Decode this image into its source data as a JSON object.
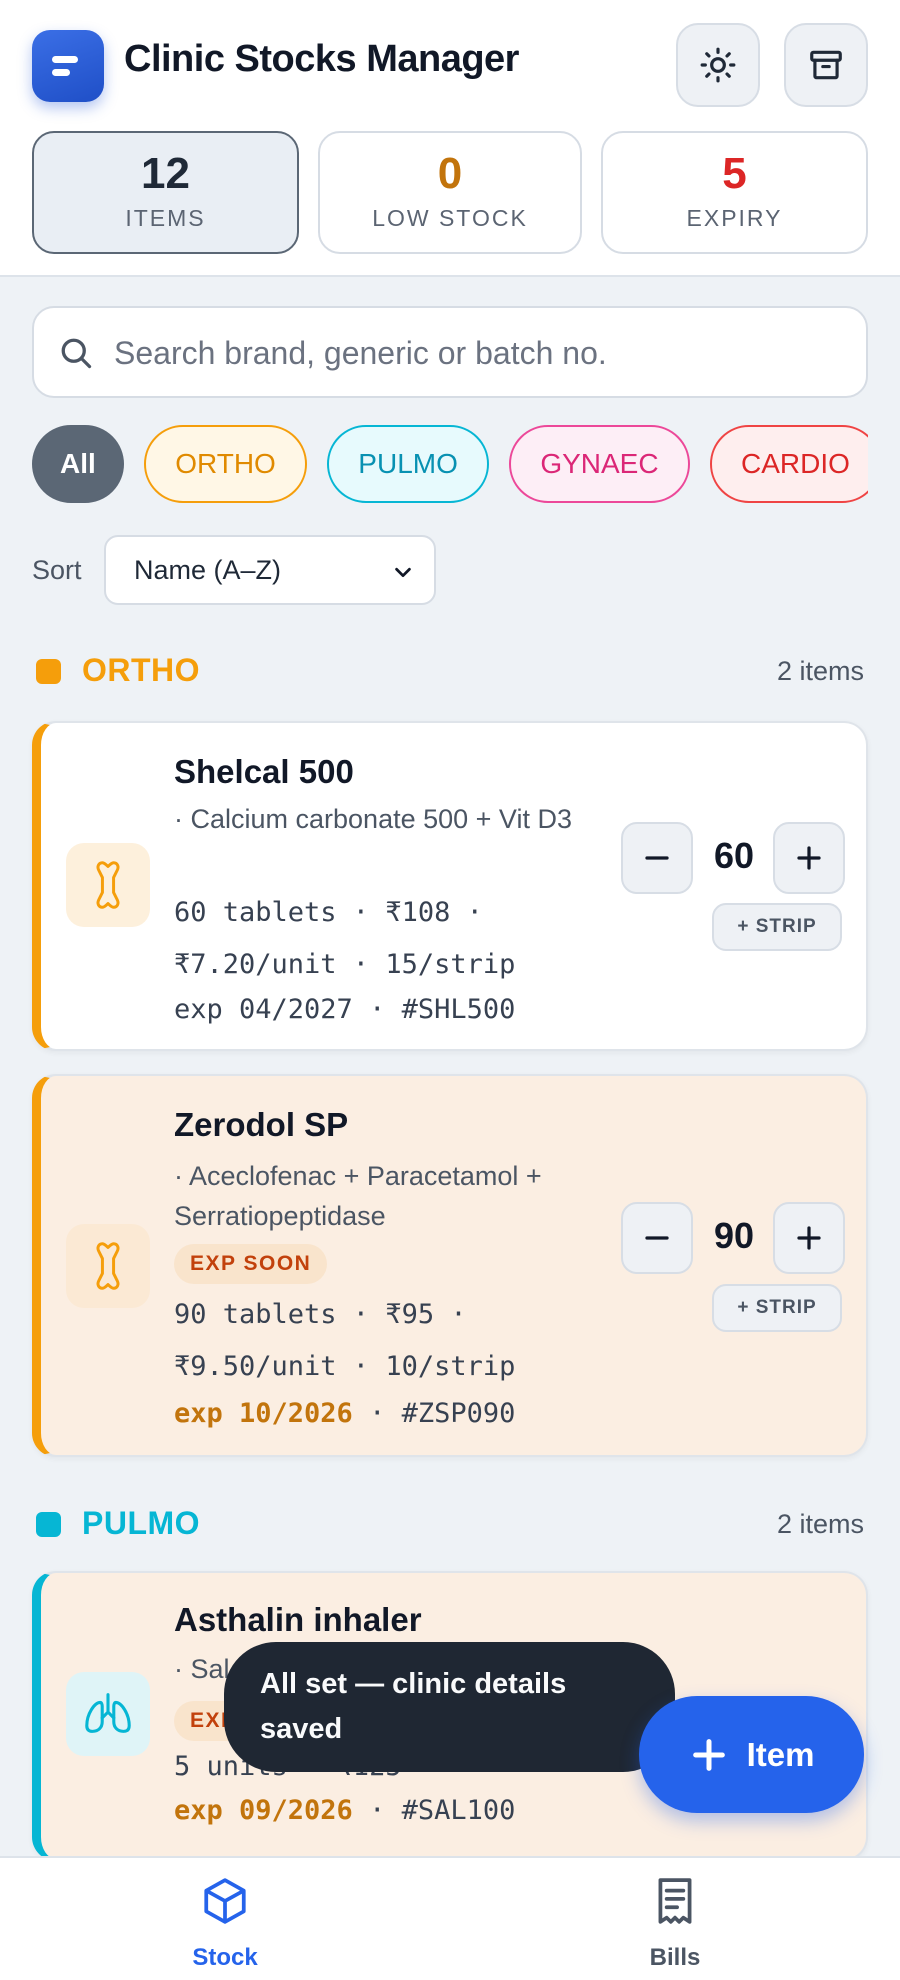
{
  "app": {
    "title": "Clinic Stocks Manager"
  },
  "header": {
    "theme_icon": "sun-icon",
    "archive_icon": "archive-icon"
  },
  "stats": [
    {
      "value": "12",
      "label": "ITEMS",
      "color": "#1f2937"
    },
    {
      "value": "0",
      "label": "LOW STOCK",
      "color": "#c2740c"
    },
    {
      "value": "5",
      "label": "EXPIRY",
      "color": "#dc2626"
    }
  ],
  "search": {
    "placeholder": "Search brand, generic or batch no.",
    "value": ""
  },
  "filters": [
    {
      "label": "All",
      "selected": true
    },
    {
      "label": "ORTHO",
      "color": "#f59e0b"
    },
    {
      "label": "PULMO",
      "color": "#06b6d4"
    },
    {
      "label": "GYNAEC",
      "color": "#ec4899"
    },
    {
      "label": "CARDIO",
      "color": "#ef4444"
    }
  ],
  "sort": {
    "label": "Sort",
    "selected": "Name (A–Z)"
  },
  "sections": [
    {
      "name": "ORTHO",
      "count": "2 items",
      "color": "#f59e0b",
      "items": [
        {
          "brand": "Shelcal 500",
          "generic": "· Calcium carbonate 500 + Vit D3",
          "meta1": "60 tablets · ₹108 ·",
          "meta2": "₹7.20/unit · 15/strip",
          "exp": "exp 04/2027",
          "batch": " · #SHL500",
          "qty": "60",
          "strip_label": "+ STRIP",
          "icon": "bone-icon"
        },
        {
          "brand": "Zerodol SP",
          "generic": "· Aceclofenac + Paracetamol + Serratiopeptidase",
          "badge": "EXP SOON",
          "meta1": "90 tablets · ₹95 ·",
          "meta2": "₹9.50/unit · 10/strip",
          "exp": "exp 10/2026",
          "batch": " · #ZSP090",
          "qty": "90",
          "strip_label": "+ STRIP",
          "icon": "bone-icon"
        }
      ]
    },
    {
      "name": "PULMO",
      "count": "2 items",
      "color": "#06b6d4",
      "items": [
        {
          "brand": "Asthalin inhaler",
          "generic": "· Sal",
          "badge": "EXP",
          "meta1": "5 units · ₹125",
          "exp": "exp 09/2026",
          "batch": " · #SAL100",
          "icon": "lungs-icon"
        }
      ]
    }
  ],
  "toast": {
    "message": "All set — clinic details saved"
  },
  "fab": {
    "label": "Item"
  },
  "nav": [
    {
      "label": "Stock",
      "icon": "box-icon",
      "active": true
    },
    {
      "label": "Bills",
      "icon": "receipt-icon",
      "active": false
    }
  ]
}
